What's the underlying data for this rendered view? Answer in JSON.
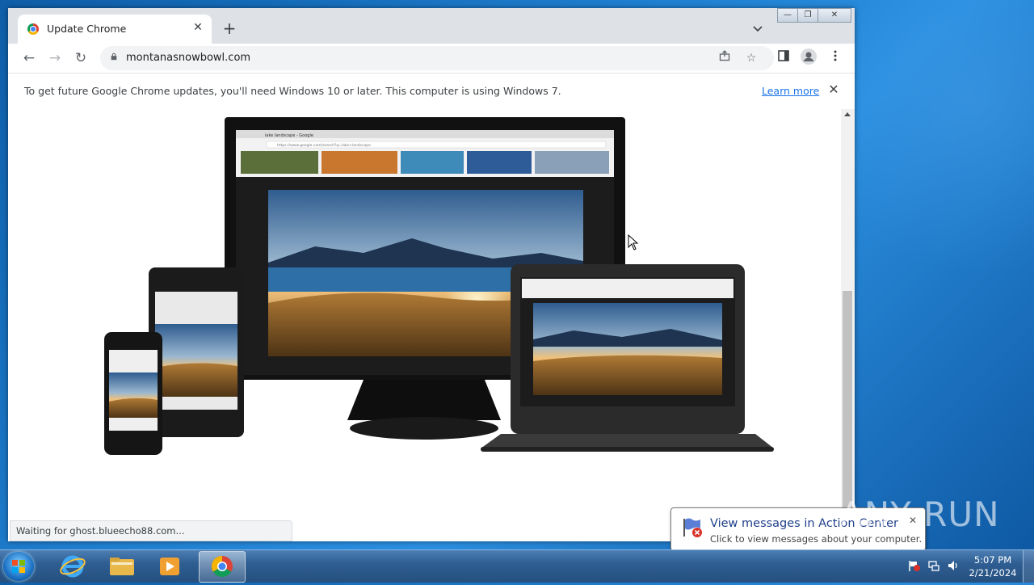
{
  "browser": {
    "tab": {
      "title": "Update Chrome",
      "close": "✕"
    },
    "new_tab": "+",
    "tab_search": "⌄",
    "window_controls": {
      "minimize": "—",
      "restore": "❐",
      "close": "✕"
    },
    "nav": {
      "back": "←",
      "forward": "→",
      "reload": "↻"
    },
    "url": "montanasnowbowl.com",
    "infobar": {
      "message": "To get future Google Chrome updates, you'll need Windows 10 or later. This computer is using Windows 7.",
      "learn_more": "Learn more",
      "close": "✕"
    },
    "status_text": "Waiting for ghost.blueecho88.com..."
  },
  "page": {
    "monitor_screen": {
      "tab_label": "lake landscape - Google",
      "address": "https://www.google.com/search?q=lake+landscape"
    }
  },
  "notification": {
    "title": "View messages in Action Center",
    "body": "Click to view messages about your computer.",
    "close": "✕"
  },
  "taskbar": {
    "clock_time": "5:07 PM",
    "clock_date": "2/21/2024"
  },
  "watermark": "ANY RUN",
  "colors": {
    "accent": "#1a73e8",
    "taskbar": "#2f5e93",
    "desktop": "#1f7fd0"
  }
}
